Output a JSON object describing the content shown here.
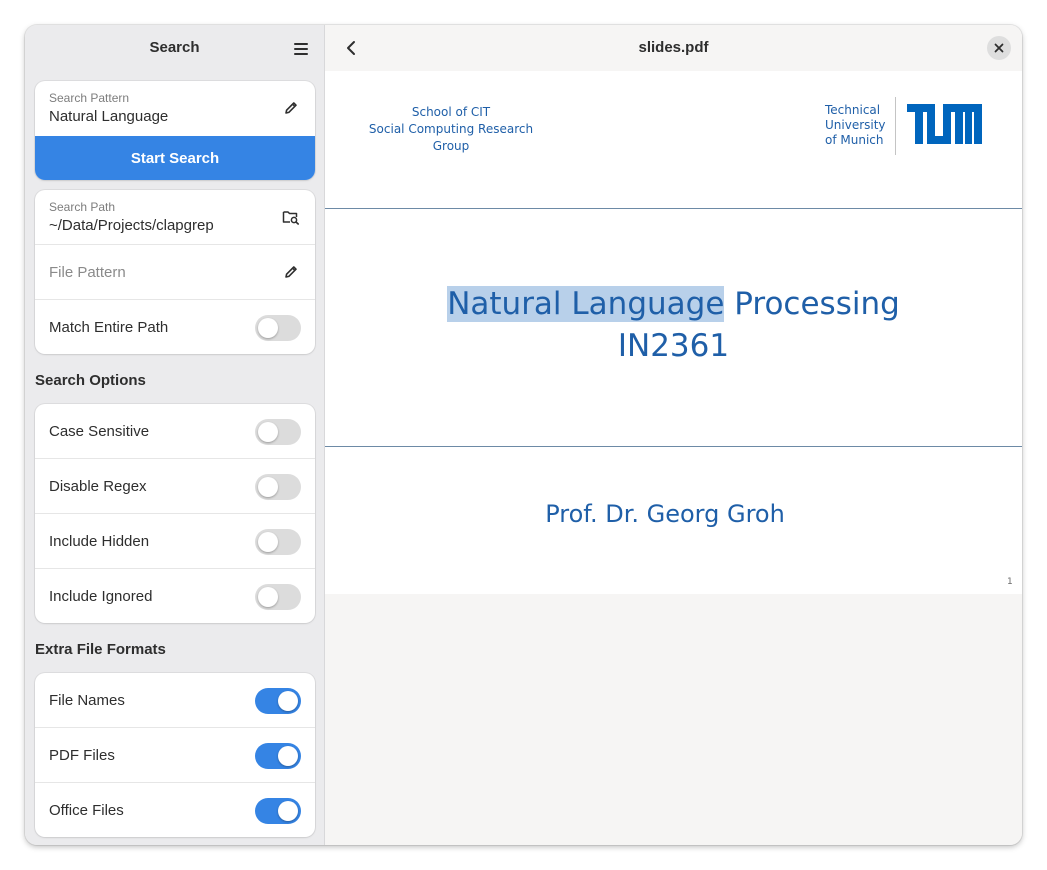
{
  "sidebar": {
    "title": "Search",
    "search_pattern": {
      "caption": "Search Pattern",
      "value": "Natural Language"
    },
    "start_button": "Start Search",
    "search_path": {
      "caption": "Search Path",
      "value": "~/Data/Projects/clapgrep"
    },
    "file_pattern": {
      "placeholder": "File Pattern"
    },
    "match_entire_path": {
      "label": "Match Entire Path",
      "on": false
    },
    "search_options": {
      "title": "Search Options",
      "items": [
        {
          "label": "Case Sensitive",
          "on": false
        },
        {
          "label": "Disable Regex",
          "on": false
        },
        {
          "label": "Include Hidden",
          "on": false
        },
        {
          "label": "Include Ignored",
          "on": false
        }
      ]
    },
    "extra_formats": {
      "title": "Extra File Formats",
      "items": [
        {
          "label": "File Names",
          "on": true
        },
        {
          "label": "PDF Files",
          "on": true
        },
        {
          "label": "Office Files",
          "on": true
        }
      ]
    }
  },
  "viewer": {
    "title": "slides.pdf",
    "slide": {
      "dept_line1": "School of CIT",
      "dept_line2": "Social Computing Research Group",
      "uni_line1": "Technical",
      "uni_line2": "University",
      "uni_line3": "of Munich",
      "title_highlight": "Natural Language",
      "title_rest": " Processing",
      "course_code": "IN2361",
      "author": "Prof. Dr. Georg Groh",
      "page_number": "1"
    }
  },
  "colors": {
    "accent": "#3584e4",
    "slide_text": "#1f5fa8",
    "highlight": "#b8d0ea",
    "sidebar_bg": "#ebebed"
  }
}
